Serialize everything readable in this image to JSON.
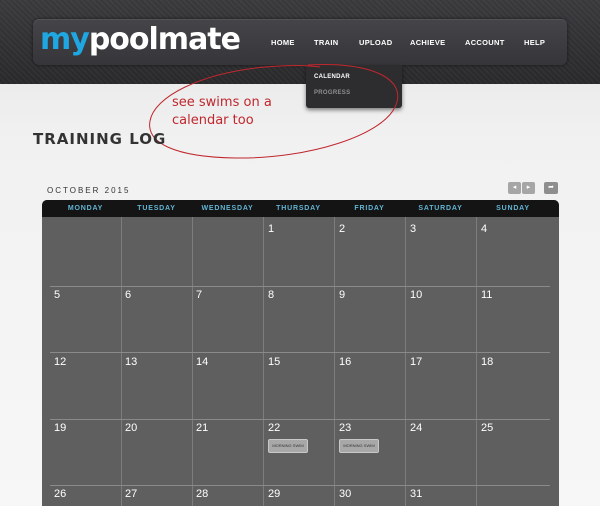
{
  "brand": {
    "my": "my",
    "rest": "poolmate"
  },
  "nav": {
    "home": "HOME",
    "train": "TRAIN",
    "upload": "UPLOAD",
    "achieve": "ACHIEVE",
    "account": "ACCOUNT",
    "help": "HELP"
  },
  "dropdown": {
    "calendar": "CALENDAR",
    "progress": "PROGRESS"
  },
  "annotation": {
    "line1": "see swims on a",
    "line2": "calendar too"
  },
  "page": {
    "title": "TRAINING LOG",
    "month": "OCTOBER 2015"
  },
  "controls": {
    "prev": "◂",
    "next": "▸",
    "share": "➦"
  },
  "weekdays": [
    "MONDAY",
    "TUESDAY",
    "WEDNESDAY",
    "THURSDAY",
    "FRIDAY",
    "SATURDAY",
    "SUNDAY"
  ],
  "days": {
    "w1": [
      "",
      "",
      "",
      "1",
      "2",
      "3",
      "4"
    ],
    "w2": [
      "5",
      "6",
      "7",
      "8",
      "9",
      "10",
      "11"
    ],
    "w3": [
      "12",
      "13",
      "14",
      "15",
      "16",
      "17",
      "18"
    ],
    "w4": [
      "19",
      "20",
      "21",
      "22",
      "23",
      "24",
      "25"
    ],
    "w5": [
      "26",
      "27",
      "28",
      "29",
      "30",
      "31",
      ""
    ]
  },
  "events": {
    "thu22": "MORNING SWIM",
    "fri23": "MORNING SWIM"
  },
  "colors": {
    "brand_blue": "#1ea7e1",
    "annotation_red": "#c0272d",
    "weekday_blue": "#62b5d4",
    "calendar_bg": "#5f5f5f"
  }
}
